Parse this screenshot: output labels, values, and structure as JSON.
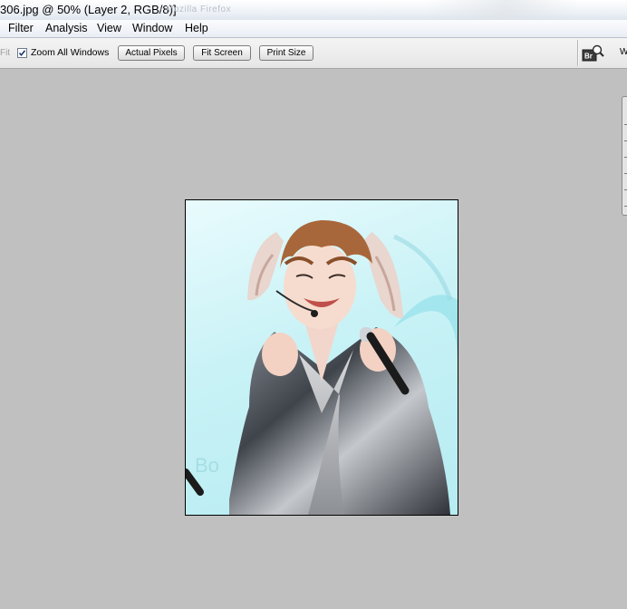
{
  "window": {
    "title": "306.jpg @ 50% (Layer 2, RGB/8)]",
    "ghost_title": "- Mozilla Firefox"
  },
  "menu": {
    "items": [
      "Filter",
      "Analysis",
      "View",
      "Window",
      "Help"
    ]
  },
  "options": {
    "fit_fragment": "Fit",
    "zoom_all_windows": {
      "label": "Zoom All Windows",
      "checked": true
    },
    "buttons": [
      "Actual Pixels",
      "Fit Screen",
      "Print Size"
    ],
    "right_fragment": "W"
  },
  "bridge_icon": {
    "icon": "bridge-icon",
    "text": "Br"
  },
  "document": {
    "image": "edited-photo-performer-with-bunny-ears"
  },
  "colors": {
    "workspace": "#c0c0c0",
    "canvas_sky": "#c8f2f6",
    "jacket": "#5a5f66"
  }
}
